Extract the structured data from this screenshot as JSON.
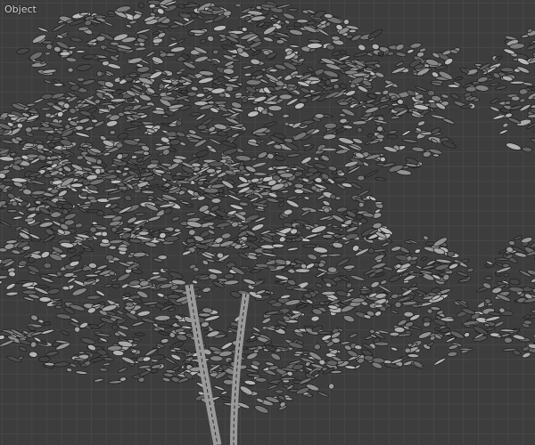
{
  "viewport": {
    "mode_label": "Object",
    "object": "tree-mesh",
    "colors": {
      "background": "#3d3d3d",
      "grid": "#474747",
      "leaf_light": "#9a9a9a",
      "leaf_dark": "#1e1e1e"
    }
  }
}
